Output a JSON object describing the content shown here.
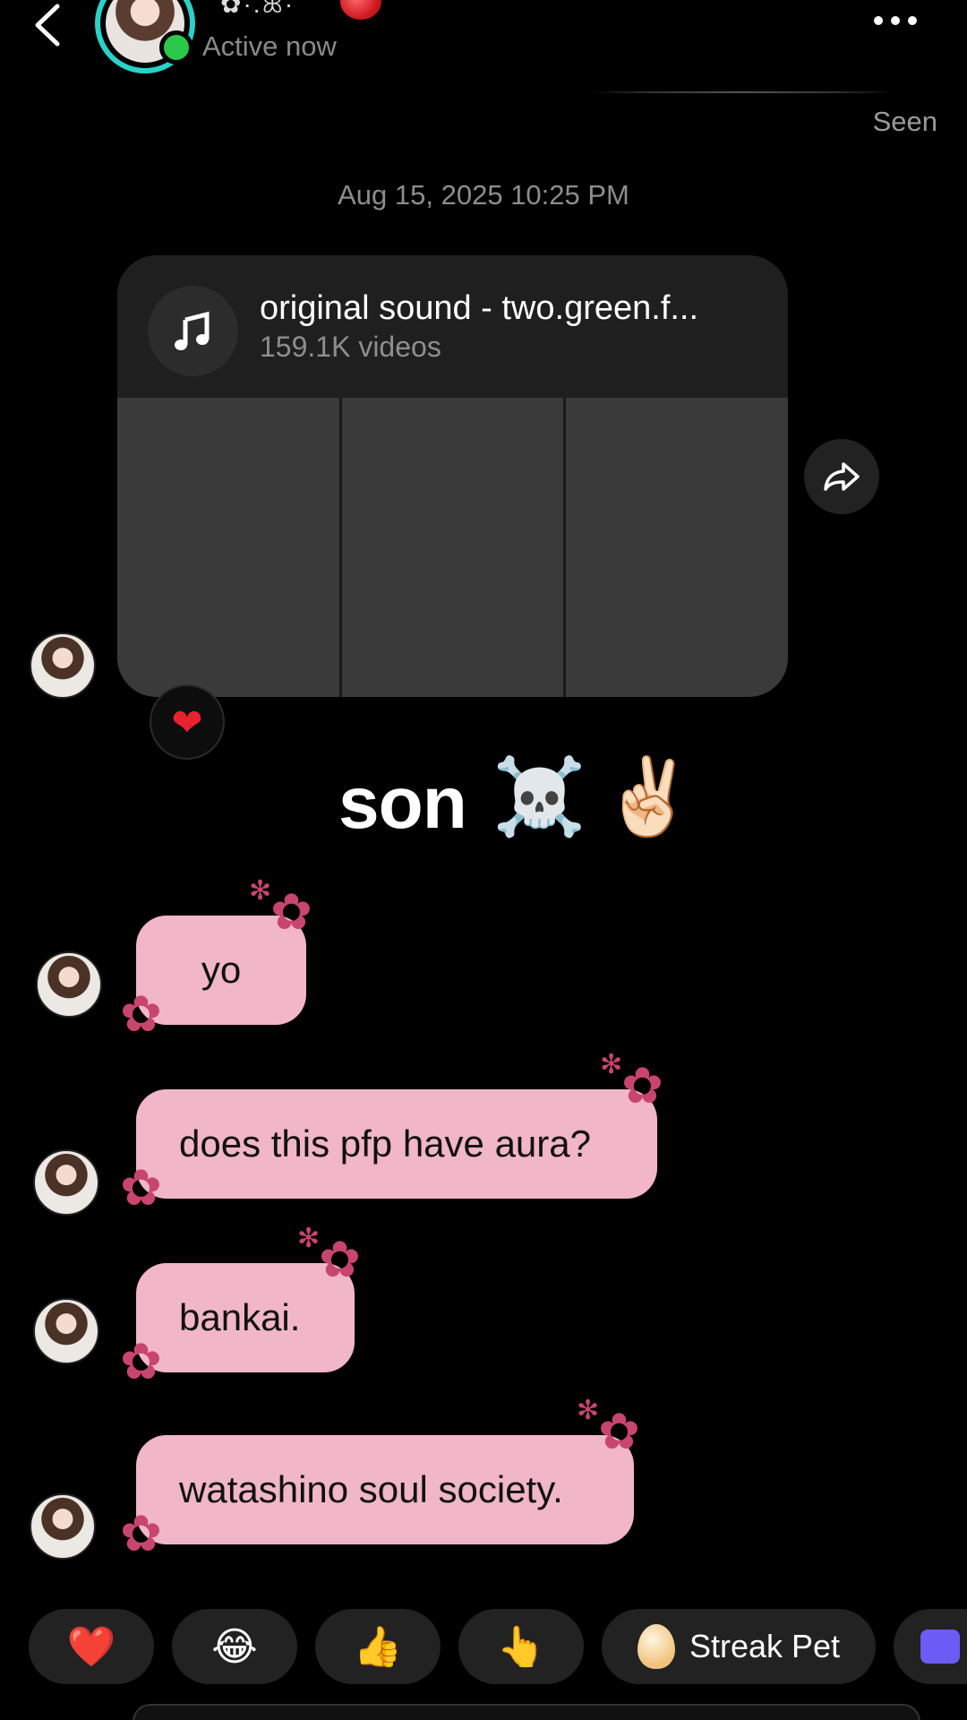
{
  "header": {
    "name_decoration": "✿·.ꕤ·",
    "status": "Active now"
  },
  "seen_label": "Seen",
  "timestamp": "Aug 15, 2025 10:25 PM",
  "sound_card": {
    "title": "original sound - two.green.f...",
    "subtitle": "159.1K videos",
    "reaction": "❤"
  },
  "sticker_message": {
    "text": "son",
    "emojis": [
      "☠️",
      "✌🏻"
    ]
  },
  "messages": [
    {
      "text": "yo"
    },
    {
      "text": "does this pfp have aura?"
    },
    {
      "text": "bankai."
    },
    {
      "text": "watashino soul society."
    }
  ],
  "quick_reactions": {
    "items": [
      "❤️",
      "😂",
      "👍",
      "👆"
    ],
    "streak_pet_label": "Streak Pet"
  },
  "colors": {
    "background": "#000000",
    "bubble": "#f1b6c8",
    "flower": "#c8456e",
    "online": "#2cc84a",
    "avatar_ring": "#2ad1c7"
  }
}
